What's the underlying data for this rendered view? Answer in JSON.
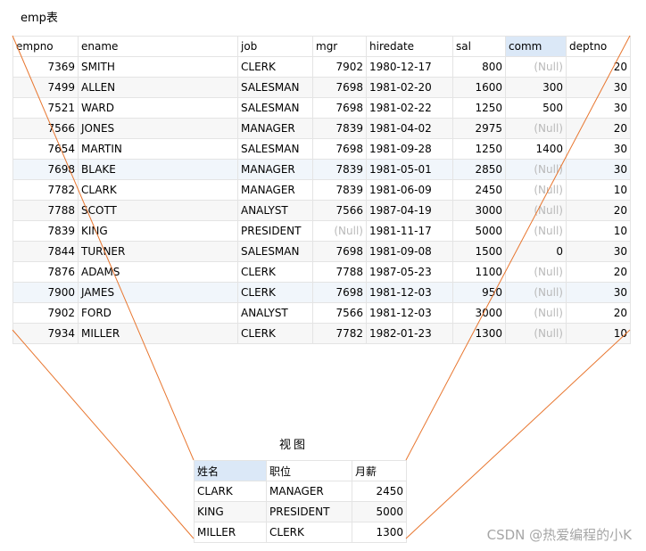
{
  "emp_title": "emp表",
  "emp_columns": [
    "empno",
    "ename",
    "job",
    "mgr",
    "hiredate",
    "sal",
    "comm",
    "deptno"
  ],
  "null_text": "(Null)",
  "emp_rows": [
    [
      "7369",
      "SMITH",
      "CLERK",
      "7902",
      "1980-12-17",
      "800",
      null,
      "20"
    ],
    [
      "7499",
      "ALLEN",
      "SALESMAN",
      "7698",
      "1981-02-20",
      "1600",
      "300",
      "30"
    ],
    [
      "7521",
      "WARD",
      "SALESMAN",
      "7698",
      "1981-02-22",
      "1250",
      "500",
      "30"
    ],
    [
      "7566",
      "JONES",
      "MANAGER",
      "7839",
      "1981-04-02",
      "2975",
      null,
      "20"
    ],
    [
      "7654",
      "MARTIN",
      "SALESMAN",
      "7698",
      "1981-09-28",
      "1250",
      "1400",
      "30"
    ],
    [
      "7698",
      "BLAKE",
      "MANAGER",
      "7839",
      "1981-05-01",
      "2850",
      null,
      "30"
    ],
    [
      "7782",
      "CLARK",
      "MANAGER",
      "7839",
      "1981-06-09",
      "2450",
      null,
      "10"
    ],
    [
      "7788",
      "SCOTT",
      "ANALYST",
      "7566",
      "1987-04-19",
      "3000",
      null,
      "20"
    ],
    [
      "7839",
      "KING",
      "PRESIDENT",
      null,
      "1981-11-17",
      "5000",
      null,
      "10"
    ],
    [
      "7844",
      "TURNER",
      "SALESMAN",
      "7698",
      "1981-09-08",
      "1500",
      "0",
      "30"
    ],
    [
      "7876",
      "ADAMS",
      "CLERK",
      "7788",
      "1987-05-23",
      "1100",
      null,
      "20"
    ],
    [
      "7900",
      "JAMES",
      "CLERK",
      "7698",
      "1981-12-03",
      "950",
      null,
      "30"
    ],
    [
      "7902",
      "FORD",
      "ANALYST",
      "7566",
      "1981-12-03",
      "3000",
      null,
      "20"
    ],
    [
      "7934",
      "MILLER",
      "CLERK",
      "7782",
      "1982-01-23",
      "1300",
      null,
      "10"
    ]
  ],
  "view_title": "视图",
  "view_columns": [
    "姓名",
    "职位",
    "月薪"
  ],
  "view_rows": [
    [
      "CLARK",
      "MANAGER",
      "2450"
    ],
    [
      "KING",
      "PRESIDENT",
      "5000"
    ],
    [
      "MILLER",
      "CLERK",
      "1300"
    ]
  ],
  "watermark": "CSDN @热爱编程的小K",
  "colors": {
    "connector": "#e8762f",
    "selected_header": "#dbe8f7",
    "null_text": "#b9b9b9"
  }
}
